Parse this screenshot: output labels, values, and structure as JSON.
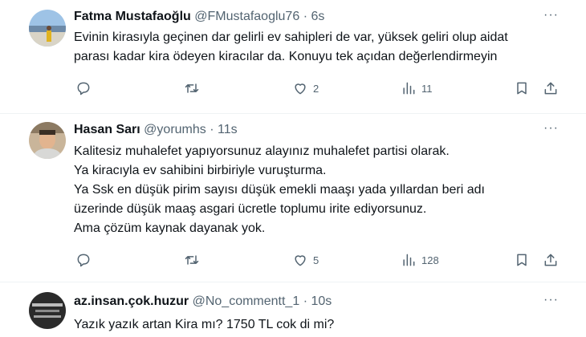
{
  "tweets": [
    {
      "name": "Fatma Mustafaoğlu",
      "handle": "@FMustafaoglu76",
      "time": "· 6s",
      "more": "···",
      "lines": [
        "Evinin kirasıyla geçinen dar gelirli ev sahipleri de var, yüksek geliri olup aidat",
        "parası kadar kira ödeyen kiracılar da. Konuyu tek açıdan değerlendirmeyin"
      ],
      "replies": "",
      "retweets": "",
      "likes": "2",
      "views": "11"
    },
    {
      "name": "Hasan Sarı",
      "handle": "@yorumhs",
      "time": "· 11s",
      "more": "···",
      "lines": [
        "Kalitesiz muhalefet yapıyorsunuz alayınız muhalefet partisi olarak.",
        "Ya kiracıyla ev sahibini birbiriyle vuruşturma.",
        "Ya  Ssk en düşük pirim sayısı düşük emekli maaşı yada yıllardan beri adı",
        "üzerinde düşük maaş asgari ücretle toplumu irite ediyorsunuz.",
        "Ama çözüm kaynak dayanak yok."
      ],
      "replies": "",
      "retweets": "",
      "likes": "5",
      "views": "128"
    },
    {
      "name": "az.insan.çok.huzur",
      "handle": "@No_commentt_1",
      "time": "· 10s",
      "more": "···",
      "lines": [
        "Yazık yazık artan Kira mı? 1750 TL cok di mi?"
      ]
    }
  ],
  "icons": {
    "reply": "reply-icon",
    "retweet": "retweet-icon",
    "like": "heart-icon",
    "views": "views-icon",
    "bookmark": "bookmark-icon",
    "share": "share-icon"
  },
  "colors": {
    "text": "#0f1419",
    "secondary": "#536471",
    "divider": "#eff3f4"
  }
}
